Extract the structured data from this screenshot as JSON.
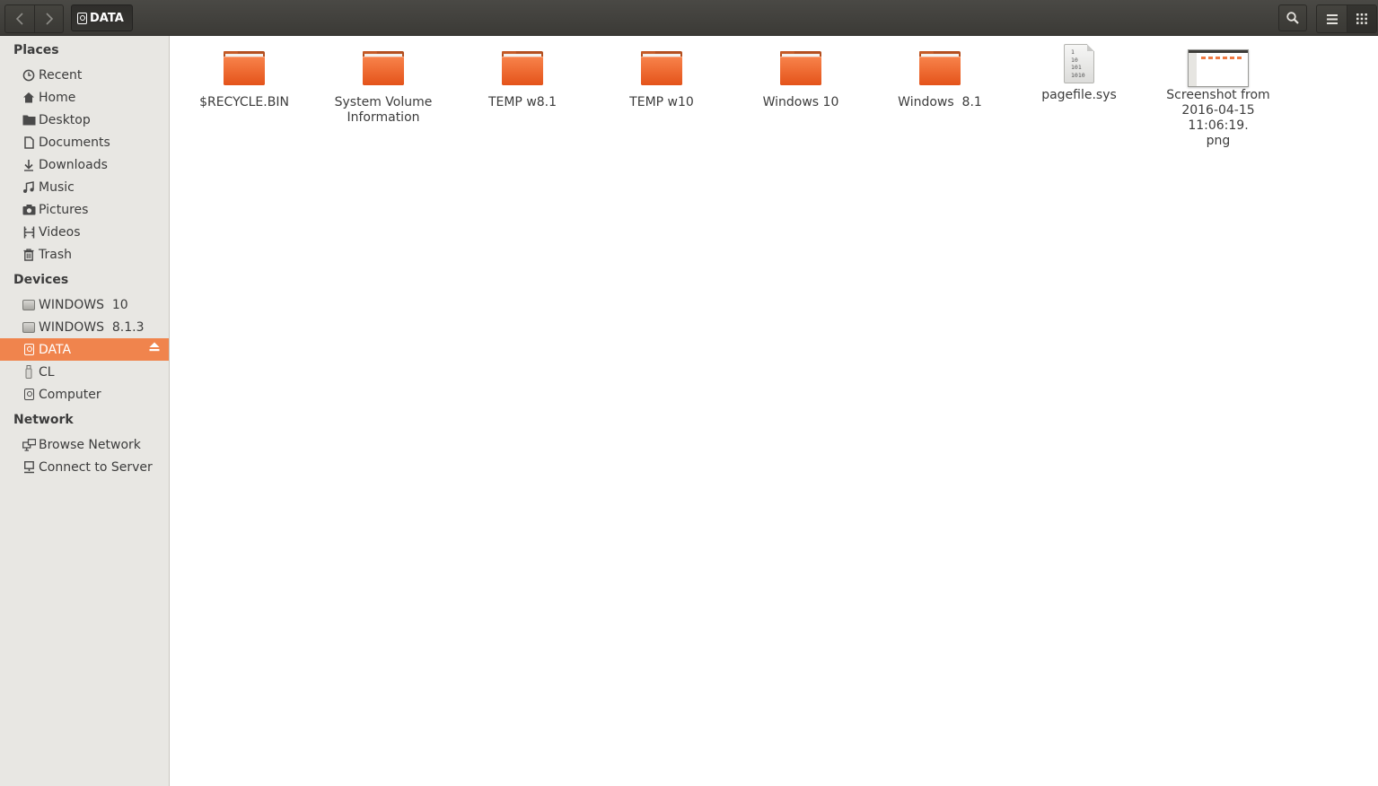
{
  "header": {
    "back_icon": "chevron-left-icon",
    "forward_icon": "chevron-right-icon",
    "path_label": "DATA",
    "search_icon": "search-icon",
    "list_view_icon": "list-view-icon",
    "grid_view_icon": "grid-view-icon"
  },
  "sidebar": {
    "places_title": "Places",
    "places": [
      {
        "label": "Recent",
        "icon": "clock-icon"
      },
      {
        "label": "Home",
        "icon": "home-icon"
      },
      {
        "label": "Desktop",
        "icon": "folder-icon"
      },
      {
        "label": "Documents",
        "icon": "document-icon"
      },
      {
        "label": "Downloads",
        "icon": "download-icon"
      },
      {
        "label": "Music",
        "icon": "music-icon"
      },
      {
        "label": "Pictures",
        "icon": "camera-icon"
      },
      {
        "label": "Videos",
        "icon": "film-icon"
      },
      {
        "label": "Trash",
        "icon": "trash-icon"
      }
    ],
    "devices_title": "Devices",
    "devices": [
      {
        "label": "WINDOWS  10",
        "icon": "hard-drive-icon"
      },
      {
        "label": "WINDOWS  8.1.3",
        "icon": "hard-drive-icon"
      },
      {
        "label": "DATA",
        "icon": "drive-icon",
        "selected": true
      },
      {
        "label": "CL",
        "icon": "usb-icon"
      },
      {
        "label": "Computer",
        "icon": "computer-drive-icon"
      }
    ],
    "network_title": "Network",
    "network": [
      {
        "label": "Browse Network",
        "icon": "network-icon"
      },
      {
        "label": "Connect to Server",
        "icon": "server-icon"
      }
    ],
    "accent_color": "#f0844d"
  },
  "files": [
    {
      "name": "$RECYCLE.BIN",
      "type": "folder"
    },
    {
      "name": "System Volume\nInformation",
      "type": "folder"
    },
    {
      "name": "TEMP w8.1",
      "type": "folder"
    },
    {
      "name": "TEMP w10",
      "type": "folder"
    },
    {
      "name": "Windows 10",
      "type": "folder"
    },
    {
      "name": "Windows  8.1",
      "type": "folder"
    },
    {
      "name": "pagefile.sys",
      "type": "binary",
      "icon_text": "1\n10\n101\n1010"
    },
    {
      "name": "Screenshot from\n2016-04-15 11:06:19.\npng",
      "type": "image"
    }
  ]
}
